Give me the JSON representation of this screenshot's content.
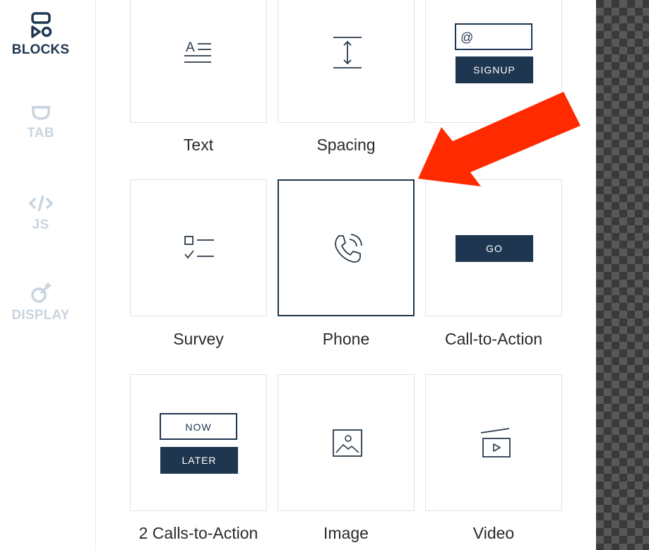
{
  "sidebar": {
    "items": [
      {
        "label": "BLOCKS",
        "icon": "blocks-icon",
        "active": true
      },
      {
        "label": "TAB",
        "icon": "tab-icon",
        "active": false
      },
      {
        "label": "JS",
        "icon": "code-icon",
        "active": false
      },
      {
        "label": "DISPLAY",
        "icon": "display-icon",
        "active": false
      }
    ]
  },
  "blocks": [
    {
      "label": "Text",
      "icon": "text-icon",
      "text": "A"
    },
    {
      "label": "Spacing",
      "icon": "spacing-icon"
    },
    {
      "label": "",
      "icon": "signup-form-icon",
      "input_placeholder": "@",
      "button_text": "SIGNUP"
    },
    {
      "label": "Survey",
      "icon": "survey-icon"
    },
    {
      "label": "Phone",
      "icon": "phone-icon",
      "selected": true
    },
    {
      "label": "Call-to-Action",
      "icon": "cta-button-icon",
      "button_text": "GO"
    },
    {
      "label": "2 Calls-to-Action",
      "icon": "two-cta-icon",
      "button1_text": "NOW",
      "button2_text": "LATER"
    },
    {
      "label": "Image",
      "icon": "image-icon"
    },
    {
      "label": "Video",
      "icon": "video-icon"
    }
  ],
  "colors": {
    "navy": "#1f3650",
    "sidebar_dim": "#c9d4de",
    "tile_border": "#dfe3e7",
    "arrow": "#ff2a00"
  }
}
